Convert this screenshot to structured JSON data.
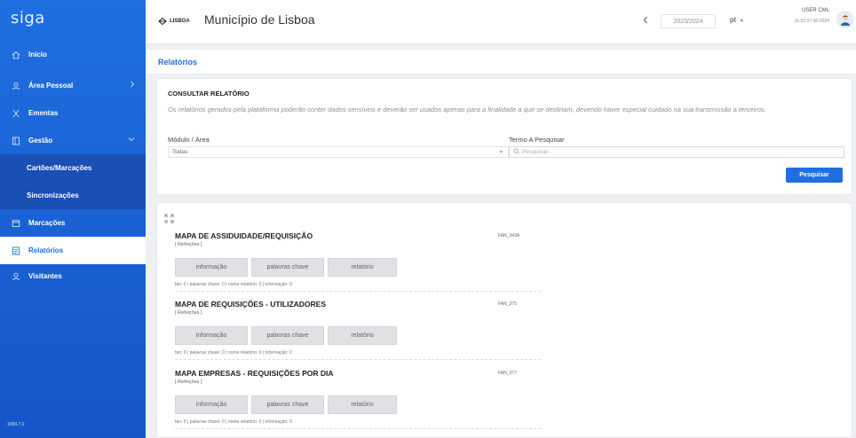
{
  "sidebar": {
    "brand": "siga",
    "version": "1000.7.0",
    "items": [
      {
        "label": "Início",
        "icon": "home-icon"
      },
      {
        "label": "Área Pessoal",
        "icon": "user-icon"
      },
      {
        "label": "Ementas",
        "icon": "utensils-icon"
      },
      {
        "label": "Gestão",
        "icon": "folder-icon"
      },
      {
        "label": "Cartões/Marcações"
      },
      {
        "label": "Sincronizações"
      },
      {
        "label": "Marcações",
        "icon": "calendar-icon"
      },
      {
        "label": "Relatórios",
        "icon": "report-icon"
      },
      {
        "label": "Visitantes",
        "icon": "visitors-icon"
      }
    ]
  },
  "header": {
    "logo_text": "LISBOA",
    "title": "Município de Lisboa",
    "year": "2023/2024",
    "lang": "pt",
    "user_name": "USER CML",
    "user_datetime": "11:52 07-06-2024"
  },
  "page": {
    "title": "Relatórios"
  },
  "search": {
    "heading": "CONSULTAR RELATÓRIO",
    "notice": "Os relatórios gerados pela plataforma poderão conter dados sensíveis e deverão ser usados apenas para a finalidade a que se destinam, devendo haver especial cuidado na sua transmissão a terceiros.",
    "module_label": "Módulo / Área",
    "module_value": "Todas",
    "term_label": "Termo A Pesquisar",
    "term_placeholder": "Pesquisar...",
    "button": "Pesquisar"
  },
  "buttons": {
    "info": "informação",
    "keywords": "palavras chave",
    "report": "relatório"
  },
  "reports": [
    {
      "title": "MAPA DE ASSIDUIDADE/REQUISIÇÃO",
      "code": "FAN_343A",
      "category": "[ Refeições ]",
      "stats": "fan: 0 | palavras chave: 0 | nome relatório: 0 | informação: 0"
    },
    {
      "title": "MAPA DE REQUISIÇÕES - UTILIZADORES",
      "code": "FAN_375",
      "category": "[ Refeições ]",
      "stats": "fan: 0 | palavras chave: 0 | nome relatório: 0 | informação: 0"
    },
    {
      "title": "MAPA EMPRESAS - REQUISIÇÕES POR DIA",
      "code": "FAN_377",
      "category": "[ Refeições ]",
      "stats": "fan: 0 | palavras chave: 0 | nome relatório: 0 | informação: 0"
    }
  ]
}
